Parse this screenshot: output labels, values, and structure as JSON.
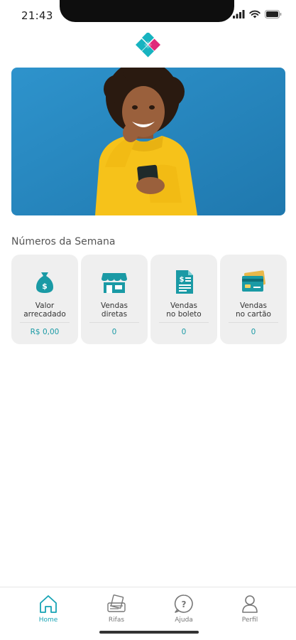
{
  "status_bar": {
    "time": "21:43"
  },
  "section_title": "Números da Semana",
  "cards": [
    {
      "label": "Valor\narrecadado",
      "value": "R$ 0,00",
      "icon": "money-bag-icon"
    },
    {
      "label": "Vendas\ndiretas",
      "value": "0",
      "icon": "storefront-icon"
    },
    {
      "label": "Vendas\nno boleto",
      "value": "0",
      "icon": "invoice-icon"
    },
    {
      "label": "Vendas\nno cartão",
      "value": "0",
      "icon": "credit-card-icon"
    }
  ],
  "nav": [
    {
      "label": "Home",
      "icon": "home-icon",
      "active": true
    },
    {
      "label": "Rifas",
      "icon": "ticket-icon",
      "active": false
    },
    {
      "label": "Ajuda",
      "icon": "help-icon",
      "active": false
    },
    {
      "label": "Perfil",
      "icon": "profile-icon",
      "active": false
    }
  ],
  "colors": {
    "accent": "#16a3b4",
    "logo_teal": "#17b3c0",
    "logo_pink": "#e0287a",
    "card_bg": "#efefef",
    "banner_blue": "#2b8cc4",
    "sweater_yellow": "#f6c21a"
  }
}
